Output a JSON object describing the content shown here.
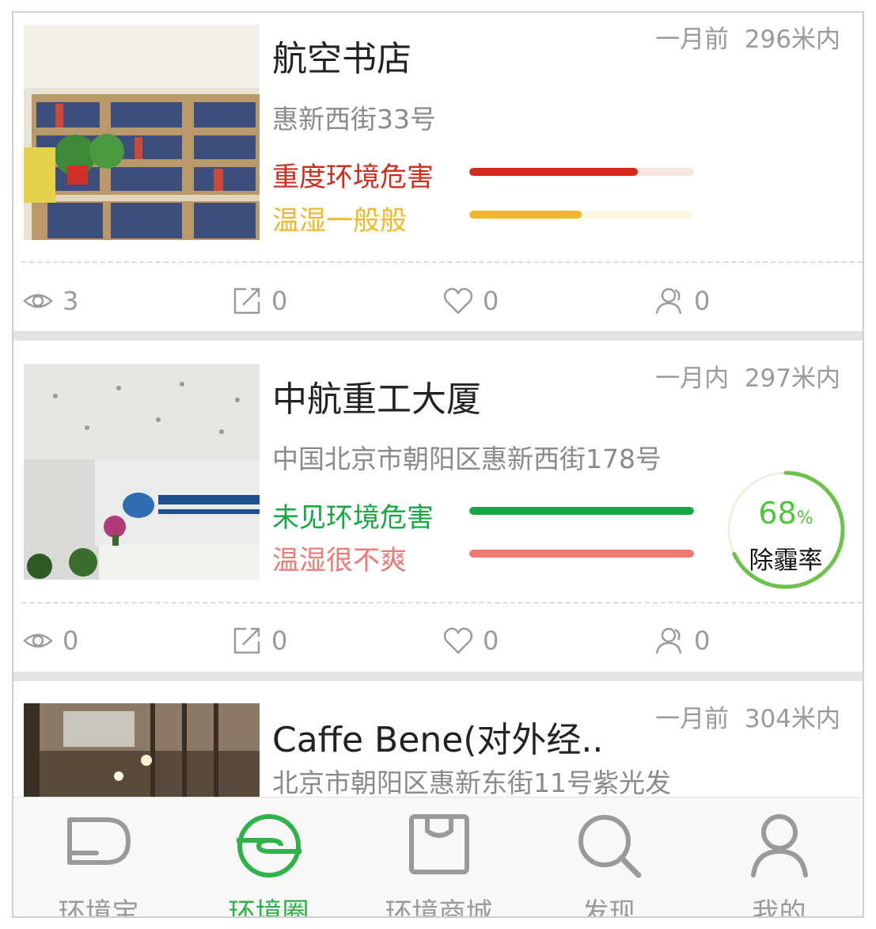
{
  "colors": {
    "accent": "#2db34a",
    "severe_red": "#d42a1a",
    "normal_yellow": "#f2b82a",
    "safe_green": "#16a843",
    "uncomfortable_pink": "#f07a72",
    "ring_green": "#6cc24a"
  },
  "feed": {
    "cards": [
      {
        "title": "航空书店",
        "time": "一月前",
        "distance": "296米内",
        "address": "惠新西街33号",
        "status1": {
          "label": "重度环境危害",
          "level": 0.75,
          "color": "#d42a1a",
          "track": "#f7e6e0"
        },
        "status2": {
          "label": "温湿一般般",
          "level": 0.5,
          "color": "#f2b82a",
          "track": "#fbf7e3"
        },
        "stats": {
          "views": "3",
          "shares": "0",
          "likes": "0",
          "people": "0"
        }
      },
      {
        "title": "中航重工大厦",
        "time": "一月内",
        "distance": "297米内",
        "address": "中国北京市朝阳区惠新西街178号",
        "status1": {
          "label": "未见环境危害",
          "level": 1.0,
          "color": "#16a843",
          "track": "#e4f5e8"
        },
        "status2": {
          "label": "温湿很不爽",
          "level": 1.0,
          "color": "#f07a72",
          "track": "#fde7e5"
        },
        "ring": {
          "value": "68",
          "unit": "%",
          "fraction": 0.68,
          "label": "除霾率"
        },
        "stats": {
          "views": "0",
          "shares": "0",
          "likes": "0",
          "people": "0"
        }
      },
      {
        "title": "Caffe Bene(对外经..",
        "time": "一月前",
        "distance": "304米内",
        "address": "北京市朝阳区惠新东街11号紫光发"
      }
    ]
  },
  "tabbar": {
    "tabs": [
      {
        "label": "环境宝",
        "icon": "environment-box-icon",
        "active": false
      },
      {
        "label": "环境圈",
        "icon": "environment-circle-icon",
        "active": true
      },
      {
        "label": "环境商城",
        "icon": "shopping-bag-icon",
        "active": false
      },
      {
        "label": "发现",
        "icon": "search-icon",
        "active": false
      },
      {
        "label": "我的",
        "icon": "user-icon",
        "active": false
      }
    ]
  }
}
